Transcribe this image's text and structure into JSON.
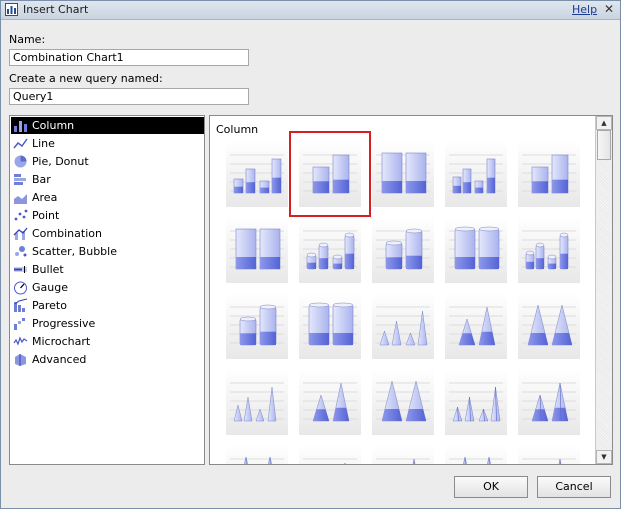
{
  "window": {
    "title": "Insert Chart",
    "help": "Help",
    "close_glyph": "✕"
  },
  "form": {
    "name_label": "Name:",
    "name_value": "Combination Chart1",
    "query_label": "Create a new query named:",
    "query_value": "Query1"
  },
  "chart_types": [
    {
      "label": "Column",
      "icon": "column-chart-icon",
      "selected": true
    },
    {
      "label": "Line",
      "icon": "line-chart-icon"
    },
    {
      "label": "Pie, Donut",
      "icon": "pie-chart-icon"
    },
    {
      "label": "Bar",
      "icon": "bar-chart-icon"
    },
    {
      "label": "Area",
      "icon": "area-chart-icon"
    },
    {
      "label": "Point",
      "icon": "point-chart-icon"
    },
    {
      "label": "Combination",
      "icon": "combination-chart-icon"
    },
    {
      "label": "Scatter, Bubble",
      "icon": "scatter-chart-icon"
    },
    {
      "label": "Bullet",
      "icon": "bullet-chart-icon"
    },
    {
      "label": "Gauge",
      "icon": "gauge-chart-icon"
    },
    {
      "label": "Pareto",
      "icon": "pareto-chart-icon"
    },
    {
      "label": "Progressive",
      "icon": "progressive-chart-icon"
    },
    {
      "label": "Microchart",
      "icon": "microchart-icon"
    },
    {
      "label": "Advanced",
      "icon": "advanced-chart-icon"
    }
  ],
  "gallery": {
    "title": "Column",
    "selected_index": 1,
    "thumbnails": [
      "clustered-column",
      "stacked-column",
      "100-percent-stacked-column",
      "3d-clustered-column",
      "3d-stacked-column",
      "3d-100-percent-stacked-column",
      "clustered-cylinder",
      "stacked-cylinder",
      "100-percent-stacked-cylinder",
      "3d-clustered-cylinder",
      "3d-stacked-cylinder",
      "3d-100-percent-stacked-cylinder",
      "clustered-cone",
      "stacked-cone",
      "100-percent-stacked-cone",
      "3d-clustered-cone",
      "3d-stacked-cone",
      "3d-100-percent-stacked-cone",
      "clustered-pyramid",
      "stacked-pyramid",
      "100-percent-stacked-pyramid",
      "3d-clustered-pyramid",
      "3d-stacked-pyramid",
      "3d-100-percent-stacked-pyramid",
      "3d-pyramid-partial"
    ]
  },
  "buttons": {
    "ok": "OK",
    "cancel": "Cancel"
  },
  "colors": {
    "accent": "#7b86e8",
    "selection_outline": "#d42020",
    "list_selected_bg": "#000000"
  }
}
